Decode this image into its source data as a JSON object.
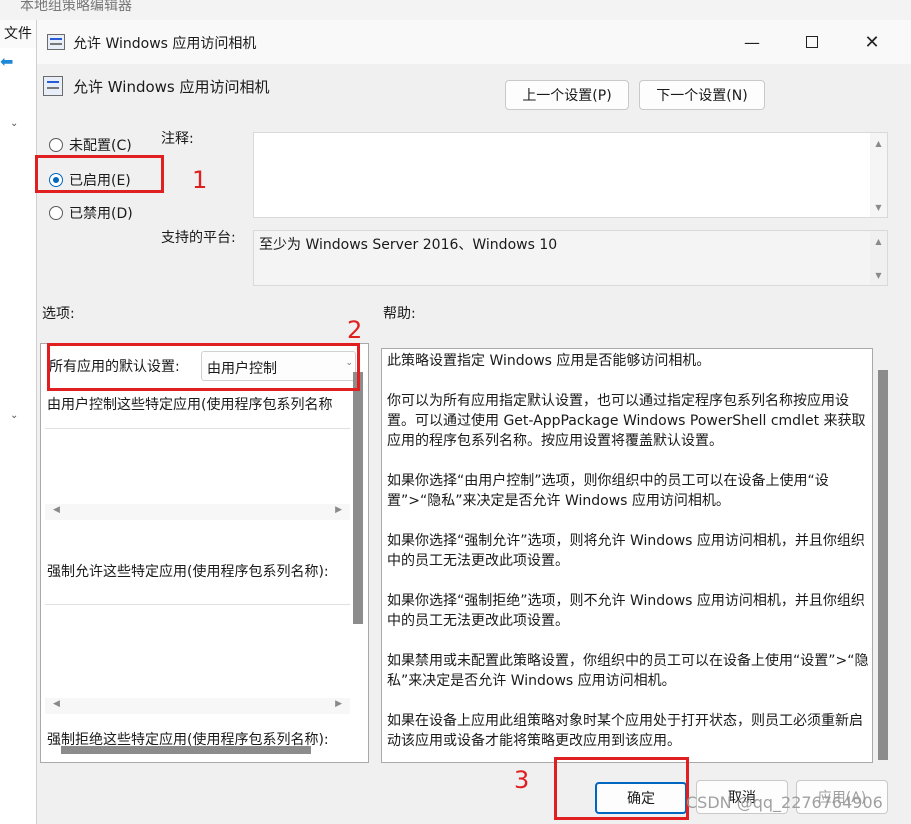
{
  "background_window": {
    "title": "本地组策略编辑器",
    "menu_file": "文件"
  },
  "dialog": {
    "title": "允许 Windows 应用访问相机",
    "heading": "允许 Windows 应用访问相机",
    "prev_setting": "上一个设置(P)",
    "next_setting": "下一个设置(N)",
    "radio_not_configured": "未配置(C)",
    "radio_enabled": "已启用(E)",
    "radio_disabled": "已禁用(D)",
    "selected_radio": "enabled",
    "comment_label": "注释:",
    "platform_label": "支持的平台:",
    "platform_value": "至少为 Windows Server 2016、Windows 10",
    "options_label": "选项:",
    "help_label": "帮助:",
    "options": {
      "default_label": "所有应用的默认设置:",
      "default_value": "由用户控制",
      "user_control_list_label": "由用户控制这些特定应用(使用程序包系列名称",
      "force_allow_list_label": "强制允许这些特定应用(使用程序包系列名称):",
      "force_deny_list_label": "强制拒绝这些特定应用(使用程序包系列名称):"
    },
    "help_paragraphs": [
      "此策略设置指定 Windows 应用是否能够访问相机。",
      "你可以为所有应用指定默认设置，也可以通过指定程序包系列名称按应用设置。可以通过使用 Get-AppPackage Windows PowerShell cmdlet 来获取应用的程序包系列名称。按应用设置将覆盖默认设置。",
      "如果你选择“由用户控制”选项，则你组织中的员工可以在设备上使用“设置”>“隐私”来决定是否允许 Windows 应用访问相机。",
      "如果你选择“强制允许”选项，则将允许 Windows 应用访问相机，并且你组织中的员工无法更改此项设置。",
      "如果你选择“强制拒绝”选项，则不允许 Windows 应用访问相机，并且你组织中的员工无法更改此项设置。",
      "如果禁用或未配置此策略设置，你组织中的员工可以在设备上使用“设置”>“隐私”来决定是否允许 Windows 应用访问相机。",
      "如果在设备上应用此组策略对象时某个应用处于打开状态，则员工必须重新启动该应用或设备才能将策略更改应用到该应用。"
    ],
    "ok": "确定",
    "cancel": "取消",
    "apply": "应用(A)"
  },
  "annotations": {
    "n1": "1",
    "n2": "2",
    "n3": "3",
    "color": "#e02020"
  },
  "watermark": "CSDN @qq_2276764906",
  "accent_color": "#0067c0"
}
